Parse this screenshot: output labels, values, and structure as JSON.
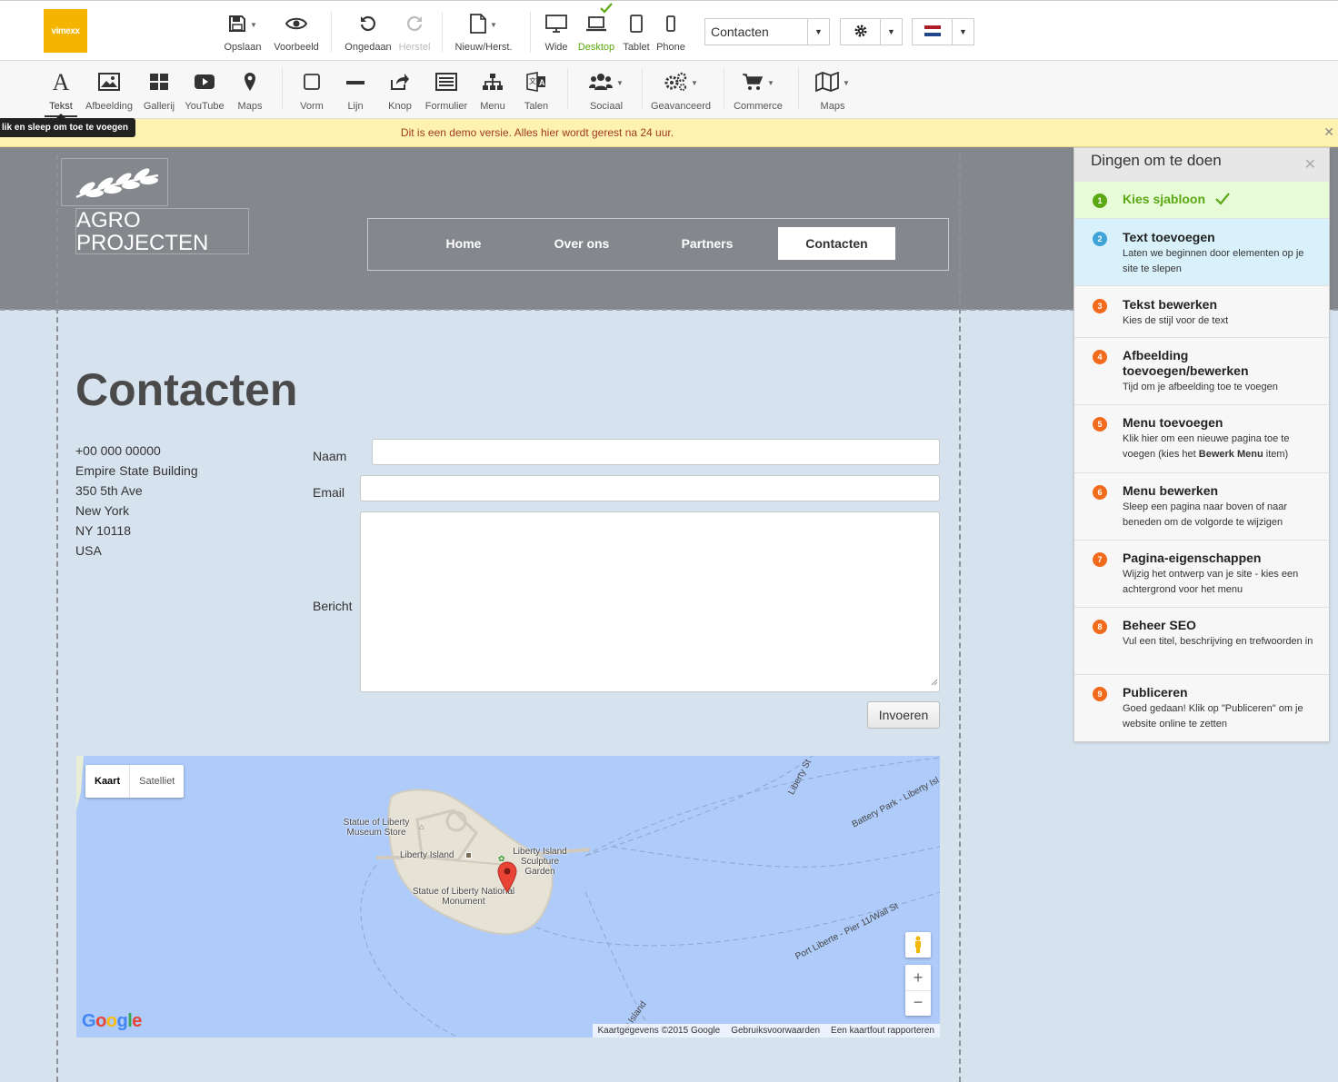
{
  "brand": {
    "logo_text": "vimexx",
    "color": "#f5b400"
  },
  "topbar": {
    "save": "Opslaan",
    "preview": "Voorbeeld",
    "undo": "Ongedaan",
    "redo": "Herstel",
    "new_restore": "Nieuw/Herst.",
    "devices": {
      "wide": "Wide",
      "desktop": "Desktop",
      "tablet": "Tablet",
      "phone": "Phone"
    },
    "page_select": "Contacten"
  },
  "toolbar": {
    "text": "Tekst",
    "image": "Afbeelding",
    "gallery": "Gallerij",
    "youtube": "YouTube",
    "maps": "Maps",
    "shape": "Vorm",
    "line": "Lijn",
    "button": "Knop",
    "form": "Formulier",
    "menu": "Menu",
    "languages": "Talen",
    "social": "Sociaal",
    "advanced": "Geavanceerd",
    "commerce": "Commerce",
    "maps2": "Maps"
  },
  "tooltip": "lik en sleep om toe te voegen",
  "notice": "Dit is een demo versie. Alles hier wordt gerest na 24 uur.",
  "site": {
    "title_line1": "AGRO",
    "title_line2": "PROJECTEN",
    "nav": [
      "Home",
      "Over ons",
      "Partners",
      "Contacten"
    ],
    "page_title": "Contacten",
    "address": [
      "+00 000 00000",
      "Empire State Building",
      "350 5th Ave",
      "New York",
      "NY 10118",
      "USA"
    ],
    "form": {
      "name": "Naam",
      "email": "Email",
      "message": "Bericht",
      "submit": "Invoeren"
    }
  },
  "map": {
    "type_map": "Kaart",
    "type_satellite": "Satelliet",
    "labels": {
      "museum_store": "Statue of Liberty Museum Store",
      "liberty_island": "Liberty Island",
      "sculpture_garden": "Liberty Island Sculpture Garden",
      "monument": "Statue of Liberty National Monument",
      "road1": "Liberty St",
      "road2": "Battery Park - Liberty Isl",
      "road3": "Port Liberte - Pier 11/Wall St",
      "road4": "y Island"
    },
    "google": "Google",
    "footer": [
      "Kaartgegevens ©2015 Google",
      "Gebruiksvoorwaarden",
      "Een kaartfout rapporteren"
    ]
  },
  "todo": {
    "title": "Dingen om te doen",
    "steps": [
      {
        "n": "1",
        "title": "Kies sjabloon",
        "desc": ""
      },
      {
        "n": "2",
        "title": "Text toevoegen",
        "desc": "Laten we beginnen door elementen op je site te slepen"
      },
      {
        "n": "3",
        "title": "Tekst bewerken",
        "desc": "Kies de stijl voor de text"
      },
      {
        "n": "4",
        "title": "Afbeelding toevoegen/bewerken",
        "desc": "Tijd om je afbeelding toe te voegen"
      },
      {
        "n": "5",
        "title": "Menu toevoegen",
        "desc_a": "Klik hier om een nieuwe pagina toe te voegen (kies het ",
        "desc_b": "Bewerk Menu",
        "desc_c": " item)"
      },
      {
        "n": "6",
        "title": "Menu bewerken",
        "desc": "Sleep een pagina naar boven of naar beneden om de volgorde te wijzigen"
      },
      {
        "n": "7",
        "title": "Pagina-eigenschappen",
        "desc": "Wijzig het ontwerp van je site - kies een achtergrond voor het menu"
      },
      {
        "n": "8",
        "title": "Beheer SEO",
        "desc": "Vul een titel, beschrijving en trefwoorden in"
      },
      {
        "n": "9",
        "title": "Publiceren",
        "desc": "Goed gedaan! Klik op \"Publiceren\" om je website online te zetten"
      }
    ]
  },
  "colors": {
    "done": "#5aa813",
    "current": "#3fa3d8",
    "todo": "#f26a1b",
    "header_band": "#84878b",
    "canvas": "#d6e2ee"
  }
}
